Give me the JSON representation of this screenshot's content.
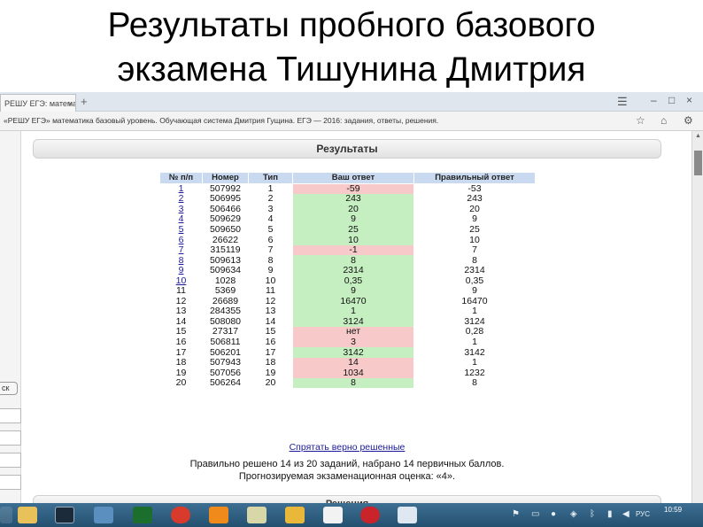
{
  "slide": {
    "title_line1": "Результаты пробного базового",
    "title_line2": "экзамена Тишунина Дмитрия"
  },
  "browser": {
    "tab_label": "РЕШУ ЕГЭ: математика",
    "tab_close": "×",
    "new_tab": "+",
    "address": "«РЕШУ ЕГЭ» математика базовый уровень. Обучающая система Дмитрия Гущина. ЕГЭ — 2016: задания, ответы, решения.",
    "back_button_label": "ск"
  },
  "results": {
    "header": "Результаты",
    "columns": [
      "№ п/п",
      "Номер",
      "Тип",
      "Ваш ответ",
      "Правильный ответ"
    ],
    "rows": [
      {
        "n": "1",
        "id": "507992",
        "type": "1",
        "answer": "-59",
        "correct": "-53",
        "status": "wrong"
      },
      {
        "n": "2",
        "id": "506995",
        "type": "2",
        "answer": "243",
        "correct": "243",
        "status": "right"
      },
      {
        "n": "3",
        "id": "506466",
        "type": "3",
        "answer": "20",
        "correct": "20",
        "status": "right"
      },
      {
        "n": "4",
        "id": "509629",
        "type": "4",
        "answer": "9",
        "correct": "9",
        "status": "right"
      },
      {
        "n": "5",
        "id": "509650",
        "type": "5",
        "answer": "25",
        "correct": "25",
        "status": "right"
      },
      {
        "n": "6",
        "id": "26622",
        "type": "6",
        "answer": "10",
        "correct": "10",
        "status": "right"
      },
      {
        "n": "7",
        "id": "315119",
        "type": "7",
        "answer": "-1",
        "correct": "7",
        "status": "wrong"
      },
      {
        "n": "8",
        "id": "509613",
        "type": "8",
        "answer": "8",
        "correct": "8",
        "status": "right"
      },
      {
        "n": "9",
        "id": "509634",
        "type": "9",
        "answer": "2314",
        "correct": "2314",
        "status": "right"
      },
      {
        "n": "10",
        "id": "1028",
        "type": "10",
        "answer": "0,35",
        "correct": "0,35",
        "status": "right"
      },
      {
        "n": "11",
        "id": "5369",
        "type": "11",
        "answer": "9",
        "correct": "9",
        "status": "right"
      },
      {
        "n": "12",
        "id": "26689",
        "type": "12",
        "answer": "16470",
        "correct": "16470",
        "status": "right"
      },
      {
        "n": "13",
        "id": "284355",
        "type": "13",
        "answer": "1",
        "correct": "1",
        "status": "right"
      },
      {
        "n": "14",
        "id": "508080",
        "type": "14",
        "answer": "3124",
        "correct": "3124",
        "status": "right"
      },
      {
        "n": "15",
        "id": "27317",
        "type": "15",
        "answer": "нет",
        "correct": "0,28",
        "status": "wrong"
      },
      {
        "n": "16",
        "id": "506811",
        "type": "16",
        "answer": "3",
        "correct": "1",
        "status": "wrong"
      },
      {
        "n": "17",
        "id": "506201",
        "type": "17",
        "answer": "3142",
        "correct": "3142",
        "status": "right"
      },
      {
        "n": "18",
        "id": "507943",
        "type": "18",
        "answer": "14",
        "correct": "1",
        "status": "wrong"
      },
      {
        "n": "19",
        "id": "507056",
        "type": "19",
        "answer": "1034",
        "correct": "1232",
        "status": "wrong"
      },
      {
        "n": "20",
        "id": "506264",
        "type": "20",
        "answer": "8",
        "correct": "8",
        "status": "right"
      }
    ],
    "hide_link": "Спрятать верно решенные",
    "summary_line1": "Правильно решено 14 из 20 заданий, набрано 14 первичных баллов.",
    "summary_line2": "Прогнозируемая экзаменационная оценка: «4».",
    "solutions_header": "Решения"
  },
  "taskbar": {
    "language": "РУС",
    "time": "10:59"
  },
  "colors": {
    "right_answer": "#c6efc1",
    "wrong_answer": "#f7c9c9",
    "table_header": "#c9d9f0",
    "link": "#1a1a9a",
    "taskbar": "#2f5f82"
  },
  "icons": [
    "menu-icon",
    "minimize-icon",
    "maximize-icon",
    "close-icon",
    "star-icon",
    "home-icon",
    "settings-icon",
    "start-button",
    "file-explorer-icon",
    "monitor-icon",
    "sound-icon",
    "flag-icon",
    "browser-icon",
    "vlc-icon",
    "calculator-icon",
    "abbyy-icon",
    "yandex-icon",
    "notes-icon"
  ]
}
